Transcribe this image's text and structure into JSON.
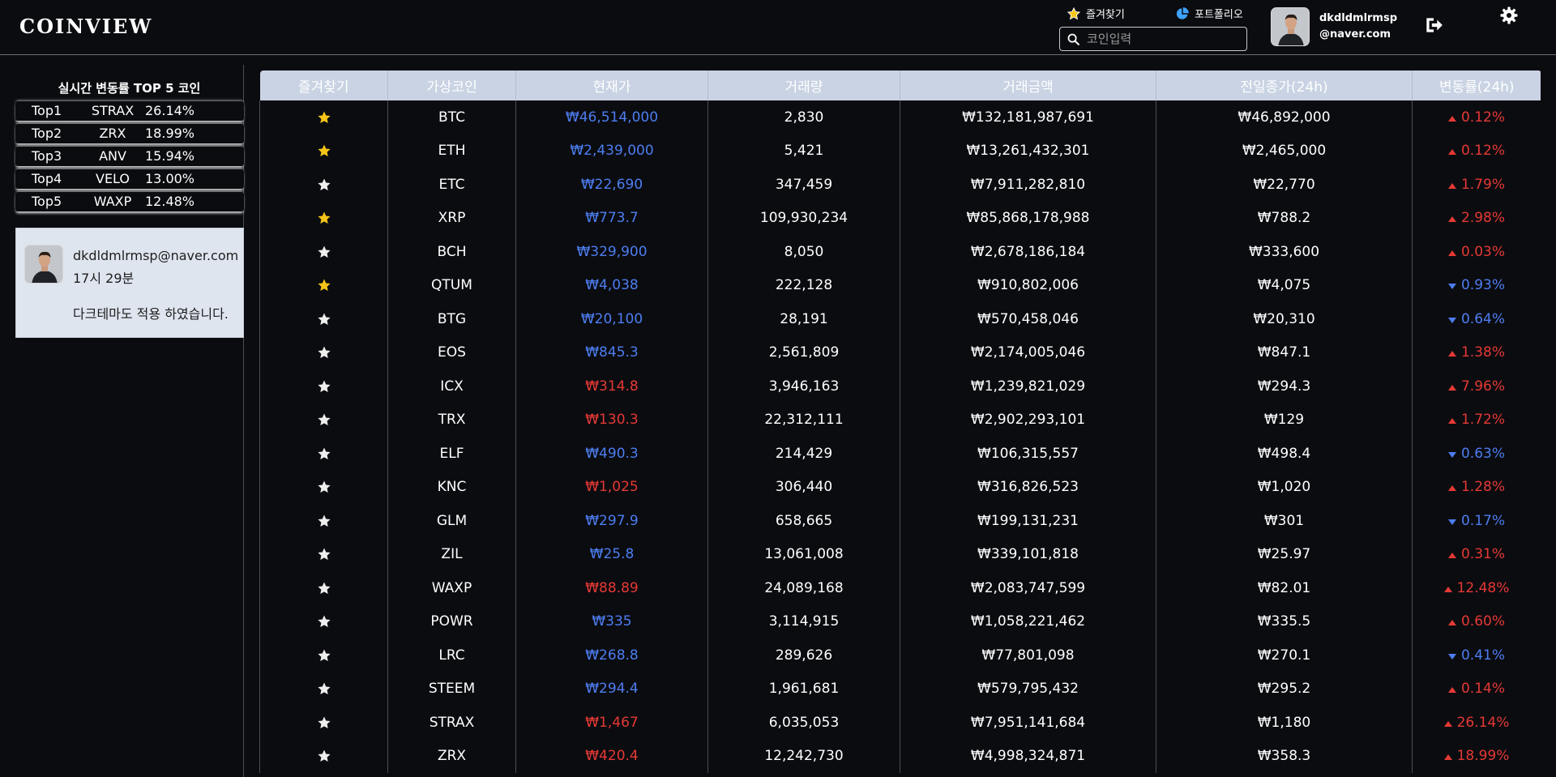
{
  "header": {
    "logo": "COINVIEW",
    "favorites_label": "즐겨찾기",
    "portfolio_label": "포트폴리오",
    "search_placeholder": "코인입력",
    "user_line1": "dkdldmlrmsp",
    "user_line2": "@naver.com"
  },
  "colors": {
    "up": "#e53935",
    "down": "#4d7df0",
    "star_active": "#f5c518",
    "star_inactive": "#eeeeee",
    "header_bg": "#c9d3e3"
  },
  "sidebar": {
    "top5_title": "실시간 변동률 TOP 5 코인",
    "top5": [
      {
        "rank": "Top1",
        "symbol": "STRAX",
        "pct": "26.14%",
        "dir": "up"
      },
      {
        "rank": "Top2",
        "symbol": "ZRX",
        "pct": "18.99%",
        "dir": "up"
      },
      {
        "rank": "Top3",
        "symbol": "ANV",
        "pct": "15.94%",
        "dir": "up"
      },
      {
        "rank": "Top4",
        "symbol": "VELO",
        "pct": "13.00%",
        "dir": "up"
      },
      {
        "rank": "Top5",
        "symbol": "WAXP",
        "pct": "12.48%",
        "dir": "up"
      }
    ],
    "notice": {
      "email": "dkdldmlrmsp@naver.com",
      "time": "17시 29분",
      "message": "다크테마도 적용 하였습니다."
    }
  },
  "table": {
    "headers": [
      "즐겨찾기",
      "가상코인",
      "현재가",
      "거래량",
      "거래금액",
      "전일종가(24h)",
      "변동률(24h)"
    ],
    "rows": [
      {
        "fav": true,
        "coin": "BTC",
        "price": "₩46,514,000",
        "price_dir": "down",
        "volume": "2,830",
        "amount": "₩132,181,987,691",
        "prev": "₩46,892,000",
        "rate": "0.12%",
        "rate_dir": "up"
      },
      {
        "fav": true,
        "coin": "ETH",
        "price": "₩2,439,000",
        "price_dir": "down",
        "volume": "5,421",
        "amount": "₩13,261,432,301",
        "prev": "₩2,465,000",
        "rate": "0.12%",
        "rate_dir": "up"
      },
      {
        "fav": false,
        "coin": "ETC",
        "price": "₩22,690",
        "price_dir": "down",
        "volume": "347,459",
        "amount": "₩7,911,282,810",
        "prev": "₩22,770",
        "rate": "1.79%",
        "rate_dir": "up"
      },
      {
        "fav": true,
        "coin": "XRP",
        "price": "₩773.7",
        "price_dir": "down",
        "volume": "109,930,234",
        "amount": "₩85,868,178,988",
        "prev": "₩788.2",
        "rate": "2.98%",
        "rate_dir": "up"
      },
      {
        "fav": false,
        "coin": "BCH",
        "price": "₩329,900",
        "price_dir": "down",
        "volume": "8,050",
        "amount": "₩2,678,186,184",
        "prev": "₩333,600",
        "rate": "0.03%",
        "rate_dir": "up"
      },
      {
        "fav": true,
        "coin": "QTUM",
        "price": "₩4,038",
        "price_dir": "down",
        "volume": "222,128",
        "amount": "₩910,802,006",
        "prev": "₩4,075",
        "rate": "0.93%",
        "rate_dir": "down"
      },
      {
        "fav": false,
        "coin": "BTG",
        "price": "₩20,100",
        "price_dir": "down",
        "volume": "28,191",
        "amount": "₩570,458,046",
        "prev": "₩20,310",
        "rate": "0.64%",
        "rate_dir": "down"
      },
      {
        "fav": false,
        "coin": "EOS",
        "price": "₩845.3",
        "price_dir": "down",
        "volume": "2,561,809",
        "amount": "₩2,174,005,046",
        "prev": "₩847.1",
        "rate": "1.38%",
        "rate_dir": "up"
      },
      {
        "fav": false,
        "coin": "ICX",
        "price": "₩314.8",
        "price_dir": "up",
        "volume": "3,946,163",
        "amount": "₩1,239,821,029",
        "prev": "₩294.3",
        "rate": "7.96%",
        "rate_dir": "up"
      },
      {
        "fav": false,
        "coin": "TRX",
        "price": "₩130.3",
        "price_dir": "up",
        "volume": "22,312,111",
        "amount": "₩2,902,293,101",
        "prev": "₩129",
        "rate": "1.72%",
        "rate_dir": "up"
      },
      {
        "fav": false,
        "coin": "ELF",
        "price": "₩490.3",
        "price_dir": "down",
        "volume": "214,429",
        "amount": "₩106,315,557",
        "prev": "₩498.4",
        "rate": "0.63%",
        "rate_dir": "down"
      },
      {
        "fav": false,
        "coin": "KNC",
        "price": "₩1,025",
        "price_dir": "up",
        "volume": "306,440",
        "amount": "₩316,826,523",
        "prev": "₩1,020",
        "rate": "1.28%",
        "rate_dir": "up"
      },
      {
        "fav": false,
        "coin": "GLM",
        "price": "₩297.9",
        "price_dir": "down",
        "volume": "658,665",
        "amount": "₩199,131,231",
        "prev": "₩301",
        "rate": "0.17%",
        "rate_dir": "down"
      },
      {
        "fav": false,
        "coin": "ZIL",
        "price": "₩25.8",
        "price_dir": "down",
        "volume": "13,061,008",
        "amount": "₩339,101,818",
        "prev": "₩25.97",
        "rate": "0.31%",
        "rate_dir": "up"
      },
      {
        "fav": false,
        "coin": "WAXP",
        "price": "₩88.89",
        "price_dir": "up",
        "volume": "24,089,168",
        "amount": "₩2,083,747,599",
        "prev": "₩82.01",
        "rate": "12.48%",
        "rate_dir": "up"
      },
      {
        "fav": false,
        "coin": "POWR",
        "price": "₩335",
        "price_dir": "down",
        "volume": "3,114,915",
        "amount": "₩1,058,221,462",
        "prev": "₩335.5",
        "rate": "0.60%",
        "rate_dir": "up"
      },
      {
        "fav": false,
        "coin": "LRC",
        "price": "₩268.8",
        "price_dir": "down",
        "volume": "289,626",
        "amount": "₩77,801,098",
        "prev": "₩270.1",
        "rate": "0.41%",
        "rate_dir": "down"
      },
      {
        "fav": false,
        "coin": "STEEM",
        "price": "₩294.4",
        "price_dir": "down",
        "volume": "1,961,681",
        "amount": "₩579,795,432",
        "prev": "₩295.2",
        "rate": "0.14%",
        "rate_dir": "up"
      },
      {
        "fav": false,
        "coin": "STRAX",
        "price": "₩1,467",
        "price_dir": "up",
        "volume": "6,035,053",
        "amount": "₩7,951,141,684",
        "prev": "₩1,180",
        "rate": "26.14%",
        "rate_dir": "up"
      },
      {
        "fav": false,
        "coin": "ZRX",
        "price": "₩420.4",
        "price_dir": "up",
        "volume": "12,242,730",
        "amount": "₩4,998,324,871",
        "prev": "₩358.3",
        "rate": "18.99%",
        "rate_dir": "up"
      }
    ]
  }
}
